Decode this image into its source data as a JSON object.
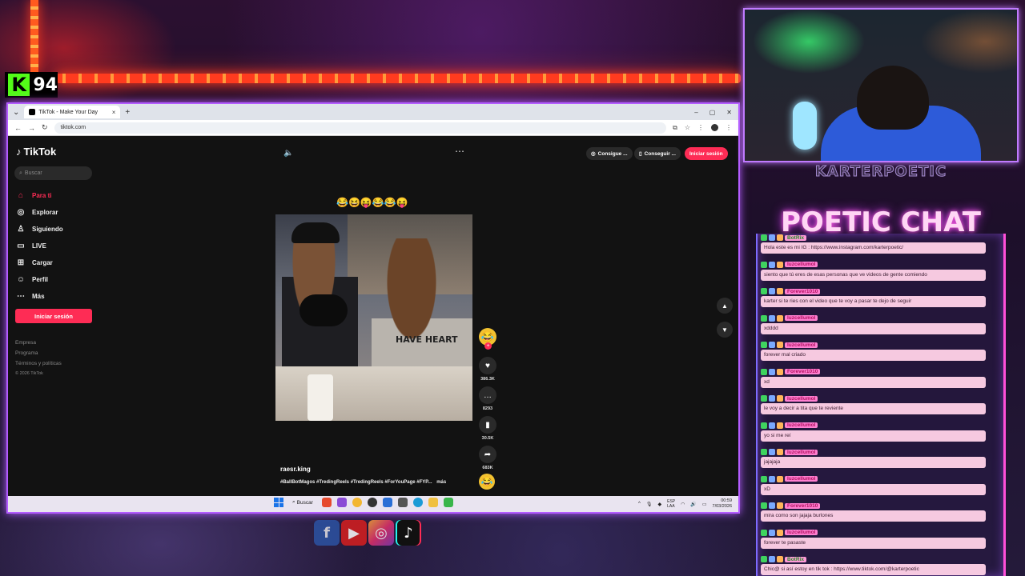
{
  "overlay": {
    "kick_count": "94",
    "kick_logo": "K",
    "streamer_name": "KARTERPOETIC",
    "chat_title": "POETIC CHAT"
  },
  "browser": {
    "tab_title": "TikTok - Make Your Day",
    "url": "tiktok.com"
  },
  "tiktok": {
    "logo": "TikTok",
    "search_placeholder": "Buscar",
    "nav": [
      {
        "label": "Para ti",
        "icon": "home-icon",
        "active": true
      },
      {
        "label": "Explorar",
        "icon": "compass-icon"
      },
      {
        "label": "Siguiendo",
        "icon": "following-icon"
      },
      {
        "label": "LIVE",
        "icon": "live-icon"
      },
      {
        "label": "Cargar",
        "icon": "upload-icon"
      },
      {
        "label": "Perfil",
        "icon": "profile-icon"
      },
      {
        "label": "Más",
        "icon": "more-icon"
      }
    ],
    "side_login": "Iniciar sesión",
    "footer": [
      "Empresa",
      "Programa",
      "Términos y políticas",
      "© 2026 TikTok"
    ],
    "pill_get_app": "Consigue ...",
    "pill_get_coins": "Conseguir ...",
    "top_login": "Iniciar sesión",
    "caption_top": "😂😆😝😂😂😝",
    "shirt_text": "HAVE HEART",
    "likes": "386.3K",
    "comments": "8293",
    "saves": "30.5K",
    "shares": "683K",
    "username": "raesr.king",
    "tags": "#BallBotMagos #TredingReels #TredingReels #ForYouPage #FYP...",
    "more": "más"
  },
  "taskbar": {
    "search": "Buscar",
    "lang1": "ESP",
    "lang2": "LAA",
    "time": "00:59",
    "date": "7/03/2026"
  },
  "chat": [
    {
      "user": "BotRix",
      "bot": true,
      "text": "Hola este es mi IG : https://www.instagram.com/karterpoetic/"
    },
    {
      "user": "luzcellumol",
      "text": "siento que tú eres de esas personas que ve videos de gente comiendo"
    },
    {
      "user": "Forever1010",
      "text": "karter si te ries con el video que te voy a pasar te dejo de seguir"
    },
    {
      "user": "luzcellumol",
      "text": "xdddd"
    },
    {
      "user": "luzcellumol",
      "text": "forever mal criado"
    },
    {
      "user": "Forever1010",
      "text": "xd"
    },
    {
      "user": "luzcellumol",
      "text": "le voy a decir a tita que te reviente"
    },
    {
      "user": "luzcellumol",
      "text": "yo si me reí"
    },
    {
      "user": "luzcellumol",
      "text": "jajajaja"
    },
    {
      "user": "luzcellumol",
      "text": "xD"
    },
    {
      "user": "Forever1010",
      "text": "mira como son jajaja burlones"
    },
    {
      "user": "luzcellumol",
      "text": "forever te pasaste"
    },
    {
      "user": "BotRix",
      "bot": true,
      "text": "Chic@ si así estoy en tik tok : https://www.tiktok.com/@karterpoetic"
    }
  ],
  "colors": {
    "tiktok_red": "#fe2c55",
    "kick_green": "#53fc18",
    "chat_bubble": "#f6c9e0",
    "overlay_border": "#b35cff"
  }
}
